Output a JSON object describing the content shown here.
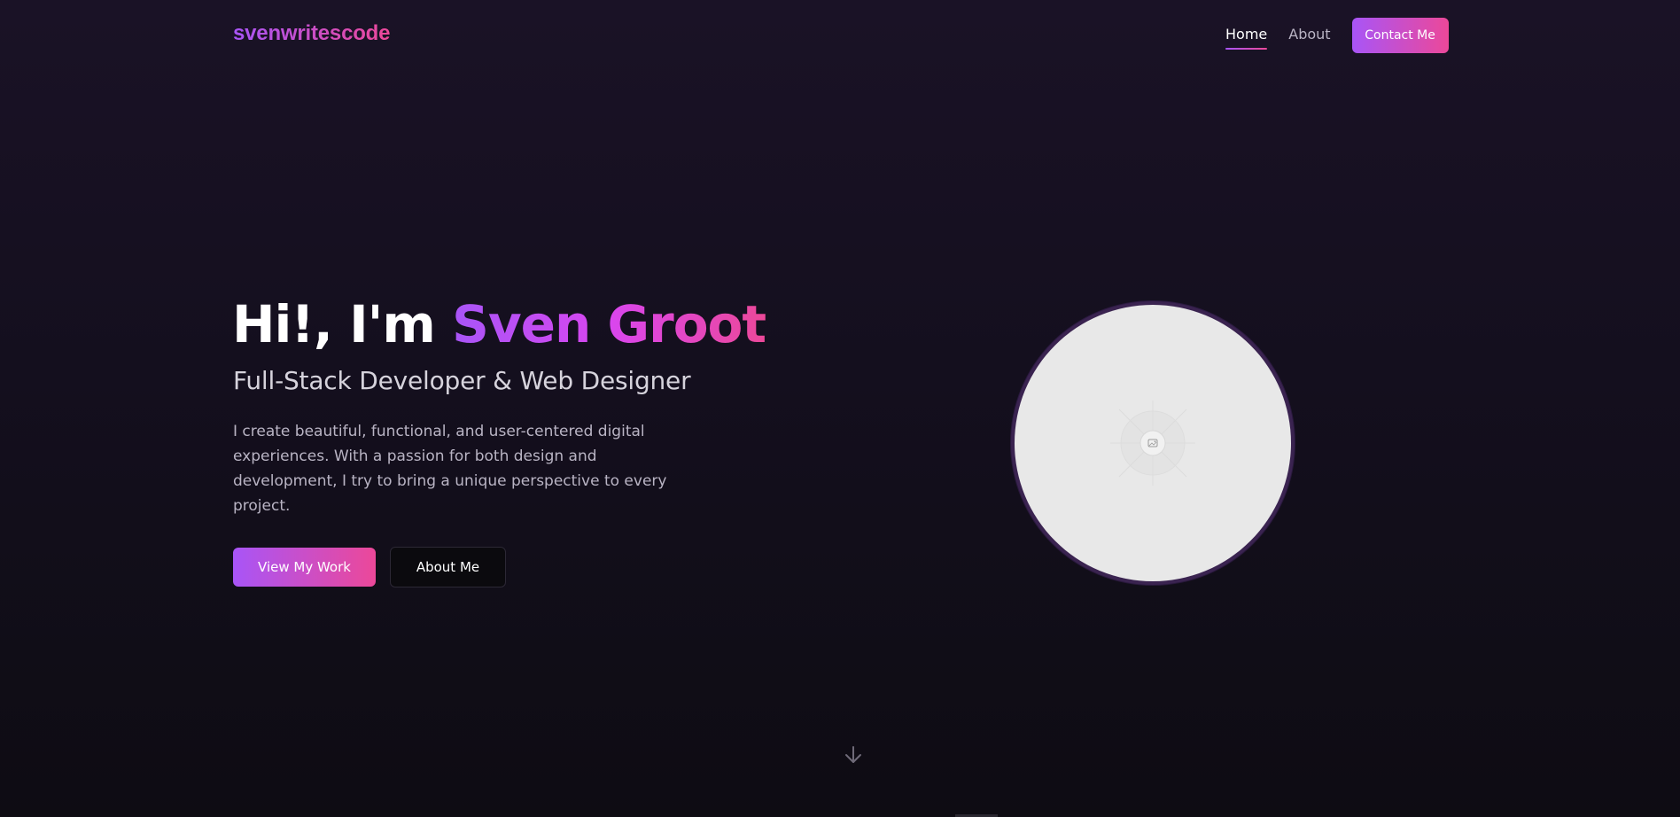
{
  "brand": {
    "logo": "svenwritescode"
  },
  "nav": {
    "items": [
      {
        "label": "Home",
        "active": true
      },
      {
        "label": "About",
        "active": false
      }
    ],
    "contact_label": "Contact Me"
  },
  "hero": {
    "greeting": "Hi!, I'm",
    "name": "Sven Groot",
    "subtitle": "Full-Stack Developer & Web Designer",
    "description": "I create beautiful, functional, and user-centered digital experiences. With a passion for both design and development, I try to bring a unique perspective to every project.",
    "primary_button": "View My Work",
    "secondary_button": "About Me"
  },
  "icons": {
    "avatar_placeholder": "image-icon",
    "scroll": "arrow-down-icon"
  },
  "colors": {
    "accent_start": "#a855f7",
    "accent_end": "#ec4899",
    "background": "#140f1e",
    "avatar_ring": "#3a2350",
    "avatar_fill": "#e8e8e8"
  }
}
